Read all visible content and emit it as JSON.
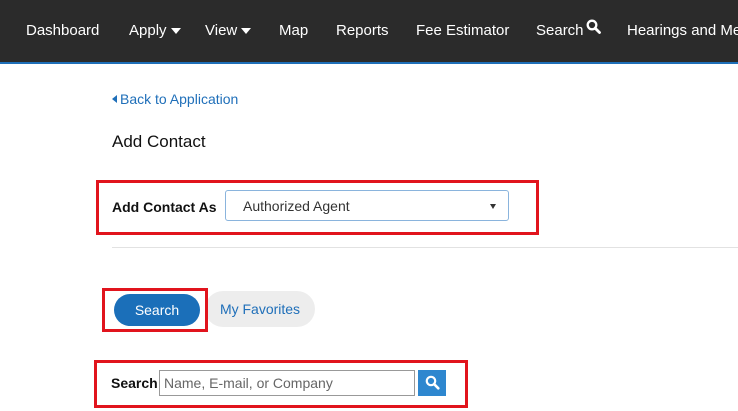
{
  "nav": {
    "items": [
      {
        "label": "Dashboard"
      },
      {
        "label": "Apply"
      },
      {
        "label": "View"
      },
      {
        "label": "Map"
      },
      {
        "label": "Reports"
      },
      {
        "label": "Fee Estimator"
      },
      {
        "label": "Search"
      },
      {
        "label": "Hearings and Me"
      }
    ]
  },
  "back_link": "Back to Application",
  "page_title": "Add Contact",
  "contact_as": {
    "label": "Add Contact As",
    "selected": "Authorized Agent"
  },
  "tabs": {
    "search": "Search",
    "favorites": "My Favorites"
  },
  "search": {
    "label": "Search",
    "placeholder": "Name, E-mail, or Company",
    "value": ""
  },
  "colors": {
    "nav_bg": "#2b2b2b",
    "accent": "#1b6fb9",
    "highlight": "#e1141d"
  }
}
